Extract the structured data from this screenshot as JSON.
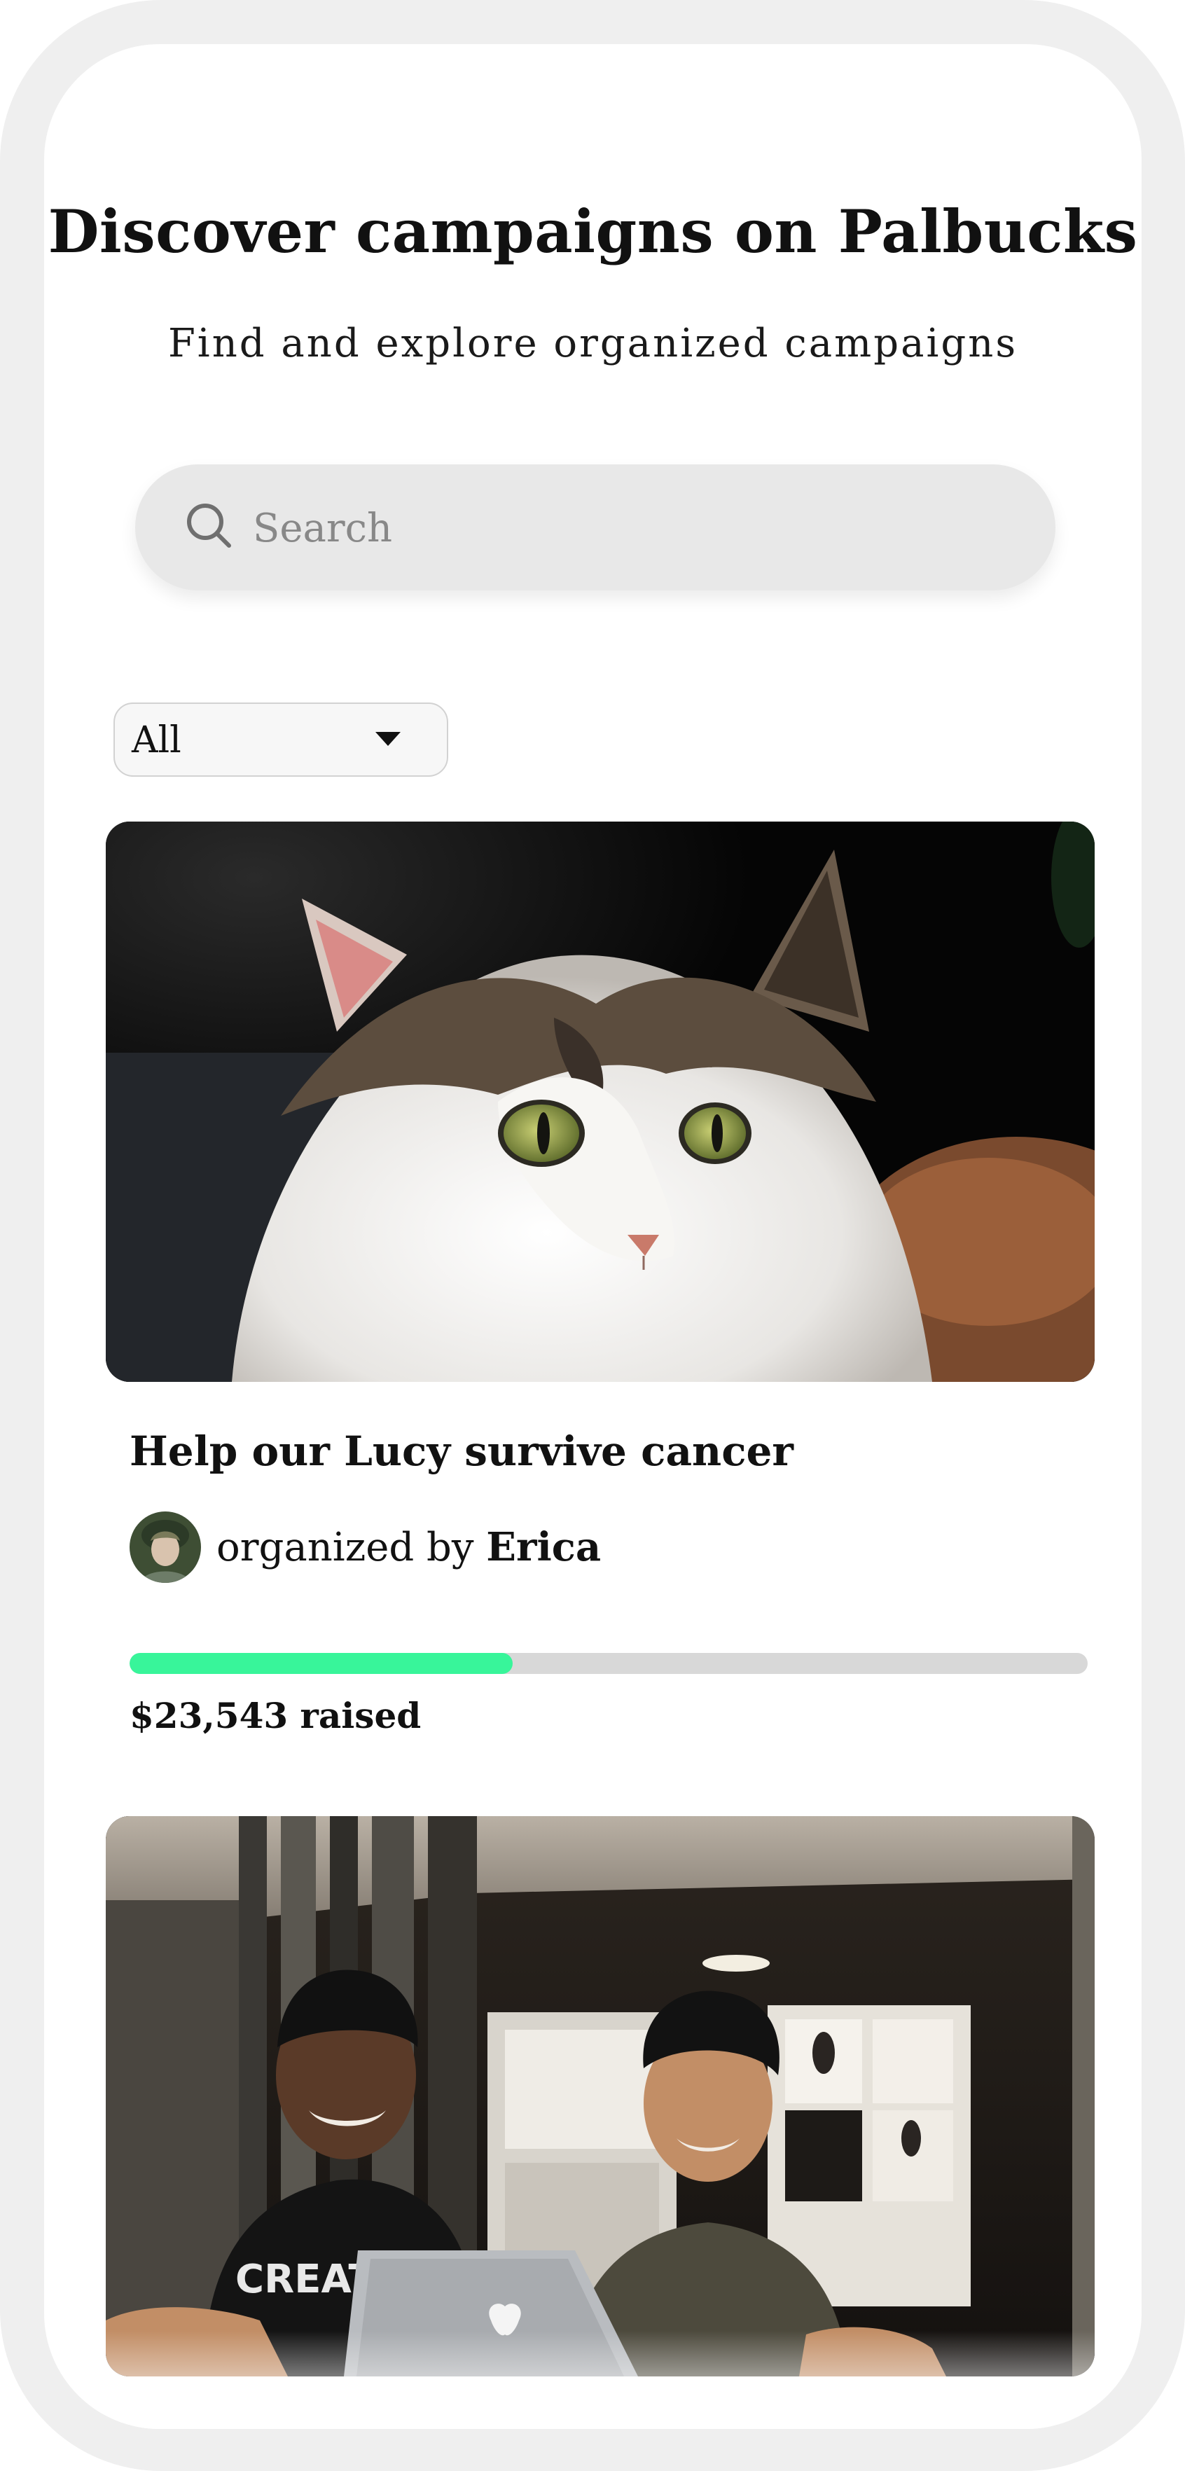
{
  "header": {
    "title": "Discover campaigns on Palbucks",
    "subtitle": "Find and explore organized campaigns"
  },
  "search": {
    "placeholder": "Search",
    "value": "",
    "icon": "search-icon"
  },
  "filter": {
    "selected": "All",
    "icon": "caret-down-icon"
  },
  "colors": {
    "progress_fill": "#38f59a",
    "progress_track": "#d8d8d8",
    "device_frame": "#efefef"
  },
  "campaigns": [
    {
      "title": "Help our Lucy survive cancer",
      "organizer_prefix": "organized by",
      "organizer_name": "Erica",
      "raised_text": "$23,543 raised",
      "progress_fraction": 0.4,
      "image": "cat-photo",
      "avatar": "organizer-avatar"
    },
    {
      "image": "people-laptop-photo"
    }
  ]
}
